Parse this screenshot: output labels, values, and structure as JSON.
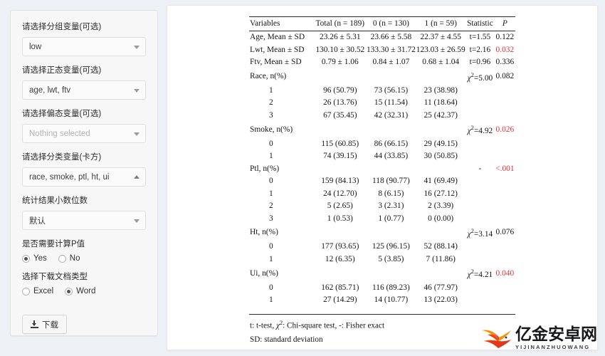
{
  "sidebar": {
    "fields": [
      {
        "label": "请选择分组变量(可选)",
        "value": "low",
        "placeholder": "Nothing selected",
        "caret": "chevron-down-icon",
        "is_placeholder": false
      },
      {
        "label": "请选择正态变量(可选)",
        "value": "age, lwt, ftv",
        "placeholder": "Nothing selected",
        "caret": "chevron-down-icon",
        "is_placeholder": false
      },
      {
        "label": "请选择偏态变量(可选)",
        "value": "Nothing selected",
        "placeholder": "Nothing selected",
        "caret": "chevron-down-icon",
        "is_placeholder": true
      },
      {
        "label": "请选择分类变量(卡方)",
        "value": "race, smoke, ptl, ht, ui",
        "placeholder": "Nothing selected",
        "caret": "chevron-up-icon",
        "is_placeholder": false
      },
      {
        "label": "统计结果小数位数",
        "value": "默认",
        "placeholder": "默认",
        "caret": "chevron-down-icon",
        "is_placeholder": false
      }
    ],
    "pvalue_group": {
      "label": "是否需要计算P值",
      "options": [
        {
          "label": "Yes",
          "checked": true
        },
        {
          "label": "No",
          "checked": false
        }
      ]
    },
    "doctype_group": {
      "label": "选择下载文档类型",
      "options": [
        {
          "label": "Excel",
          "checked": false
        },
        {
          "label": "Word",
          "checked": true
        }
      ]
    },
    "download_button": {
      "label": "下载",
      "icon": "download-icon"
    }
  },
  "table": {
    "headers": [
      "Variables",
      "Total (n = 189)",
      "0 (n = 130)",
      "1 (n = 59)",
      "Statistic",
      "P"
    ],
    "rows": [
      {
        "type": "data",
        "variable": "Age, Mean ± SD",
        "total": "23.26 ± 5.31",
        "g0": "23.66 ± 5.58",
        "g1": "22.37 ± 4.55",
        "statistic": "t=1.55",
        "stat_chi": false,
        "p": "0.122",
        "p_sig": false
      },
      {
        "type": "data",
        "variable": "Lwt, Mean ± SD",
        "total": "130.10 ± 30.52",
        "g0": "133.30 ± 31.72",
        "g1": "123.03 ± 26.59",
        "statistic": "t=2.16",
        "stat_chi": false,
        "p": "0.032",
        "p_sig": true
      },
      {
        "type": "data",
        "variable": "Ftv, Mean ± SD",
        "total": "0.79 ± 1.06",
        "g0": "0.84 ± 1.07",
        "g1": "0.68 ± 1.04",
        "statistic": "t=0.96",
        "stat_chi": false,
        "p": "0.336",
        "p_sig": false
      },
      {
        "type": "header",
        "variable": "Race, n(%)",
        "total": "",
        "g0": "",
        "g1": "",
        "statistic": "=5.00",
        "stat_chi": true,
        "p": "0.082",
        "p_sig": false
      },
      {
        "type": "level",
        "variable": "1",
        "total": "96 (50.79)",
        "g0": "73 (56.15)",
        "g1": "23 (38.98)",
        "statistic": "",
        "stat_chi": false,
        "p": "",
        "p_sig": false
      },
      {
        "type": "level",
        "variable": "2",
        "total": "26 (13.76)",
        "g0": "15 (11.54)",
        "g1": "11 (18.64)",
        "statistic": "",
        "stat_chi": false,
        "p": "",
        "p_sig": false
      },
      {
        "type": "level",
        "variable": "3",
        "total": "67 (35.45)",
        "g0": "42 (32.31)",
        "g1": "25 (42.37)",
        "statistic": "",
        "stat_chi": false,
        "p": "",
        "p_sig": false
      },
      {
        "type": "header",
        "variable": "Smoke, n(%)",
        "total": "",
        "g0": "",
        "g1": "",
        "statistic": "=4.92",
        "stat_chi": true,
        "p": "0.026",
        "p_sig": true
      },
      {
        "type": "level",
        "variable": "0",
        "total": "115 (60.85)",
        "g0": "86 (66.15)",
        "g1": "29 (49.15)",
        "statistic": "",
        "stat_chi": false,
        "p": "",
        "p_sig": false
      },
      {
        "type": "level",
        "variable": "1",
        "total": "74 (39.15)",
        "g0": "44 (33.85)",
        "g1": "30 (50.85)",
        "statistic": "",
        "stat_chi": false,
        "p": "",
        "p_sig": false
      },
      {
        "type": "header",
        "variable": "Ptl, n(%)",
        "total": "",
        "g0": "",
        "g1": "",
        "statistic": "-",
        "stat_chi": false,
        "p": "<.001",
        "p_sig": true
      },
      {
        "type": "level",
        "variable": "0",
        "total": "159 (84.13)",
        "g0": "118 (90.77)",
        "g1": "41 (69.49)",
        "statistic": "",
        "stat_chi": false,
        "p": "",
        "p_sig": false
      },
      {
        "type": "level",
        "variable": "1",
        "total": "24 (12.70)",
        "g0": "8 (6.15)",
        "g1": "16 (27.12)",
        "statistic": "",
        "stat_chi": false,
        "p": "",
        "p_sig": false
      },
      {
        "type": "level",
        "variable": "2",
        "total": "5 (2.65)",
        "g0": "3 (2.31)",
        "g1": "2 (3.39)",
        "statistic": "",
        "stat_chi": false,
        "p": "",
        "p_sig": false
      },
      {
        "type": "level",
        "variable": "3",
        "total": "1 (0.53)",
        "g0": "1 (0.77)",
        "g1": "0 (0.00)",
        "statistic": "",
        "stat_chi": false,
        "p": "",
        "p_sig": false
      },
      {
        "type": "header",
        "variable": "Ht, n(%)",
        "total": "",
        "g0": "",
        "g1": "",
        "statistic": "=3.14",
        "stat_chi": true,
        "p": "0.076",
        "p_sig": false
      },
      {
        "type": "level",
        "variable": "0",
        "total": "177 (93.65)",
        "g0": "125 (96.15)",
        "g1": "52 (88.14)",
        "statistic": "",
        "stat_chi": false,
        "p": "",
        "p_sig": false
      },
      {
        "type": "level",
        "variable": "1",
        "total": "12 (6.35)",
        "g0": "5 (3.85)",
        "g1": "7 (11.86)",
        "statistic": "",
        "stat_chi": false,
        "p": "",
        "p_sig": false
      },
      {
        "type": "header",
        "variable": "Ui, n(%)",
        "total": "",
        "g0": "",
        "g1": "",
        "statistic": "=4.21",
        "stat_chi": true,
        "p": "0.040",
        "p_sig": true
      },
      {
        "type": "level",
        "variable": "0",
        "total": "162 (85.71)",
        "g0": "116 (89.23)",
        "g1": "46 (77.97)",
        "statistic": "",
        "stat_chi": false,
        "p": "",
        "p_sig": false
      },
      {
        "type": "level",
        "variable": "1",
        "total": "27 (14.29)",
        "g0": "14 (10.77)",
        "g1": "13 (22.03)",
        "statistic": "",
        "stat_chi": false,
        "p": "",
        "p_sig": false
      }
    ],
    "footnotes": [
      "t: t-test, χ²: Chi-square test, -: Fisher exact",
      "SD: standard deviation"
    ]
  },
  "watermark": {
    "cn": "亿金安卓网",
    "en": "YIJINANZHUOWANG",
    "icon": "phoenix-bird-logo",
    "colors": {
      "flame_orange": "#f39200",
      "flame_red": "#e2361d",
      "text": "#17181a"
    }
  },
  "colors": {
    "page_background": "#edf0f4",
    "panel_background": "#f7f7f7",
    "content_background": "#ffffff",
    "significant_p": "#e03131",
    "rule": "#2a2a2a"
  }
}
